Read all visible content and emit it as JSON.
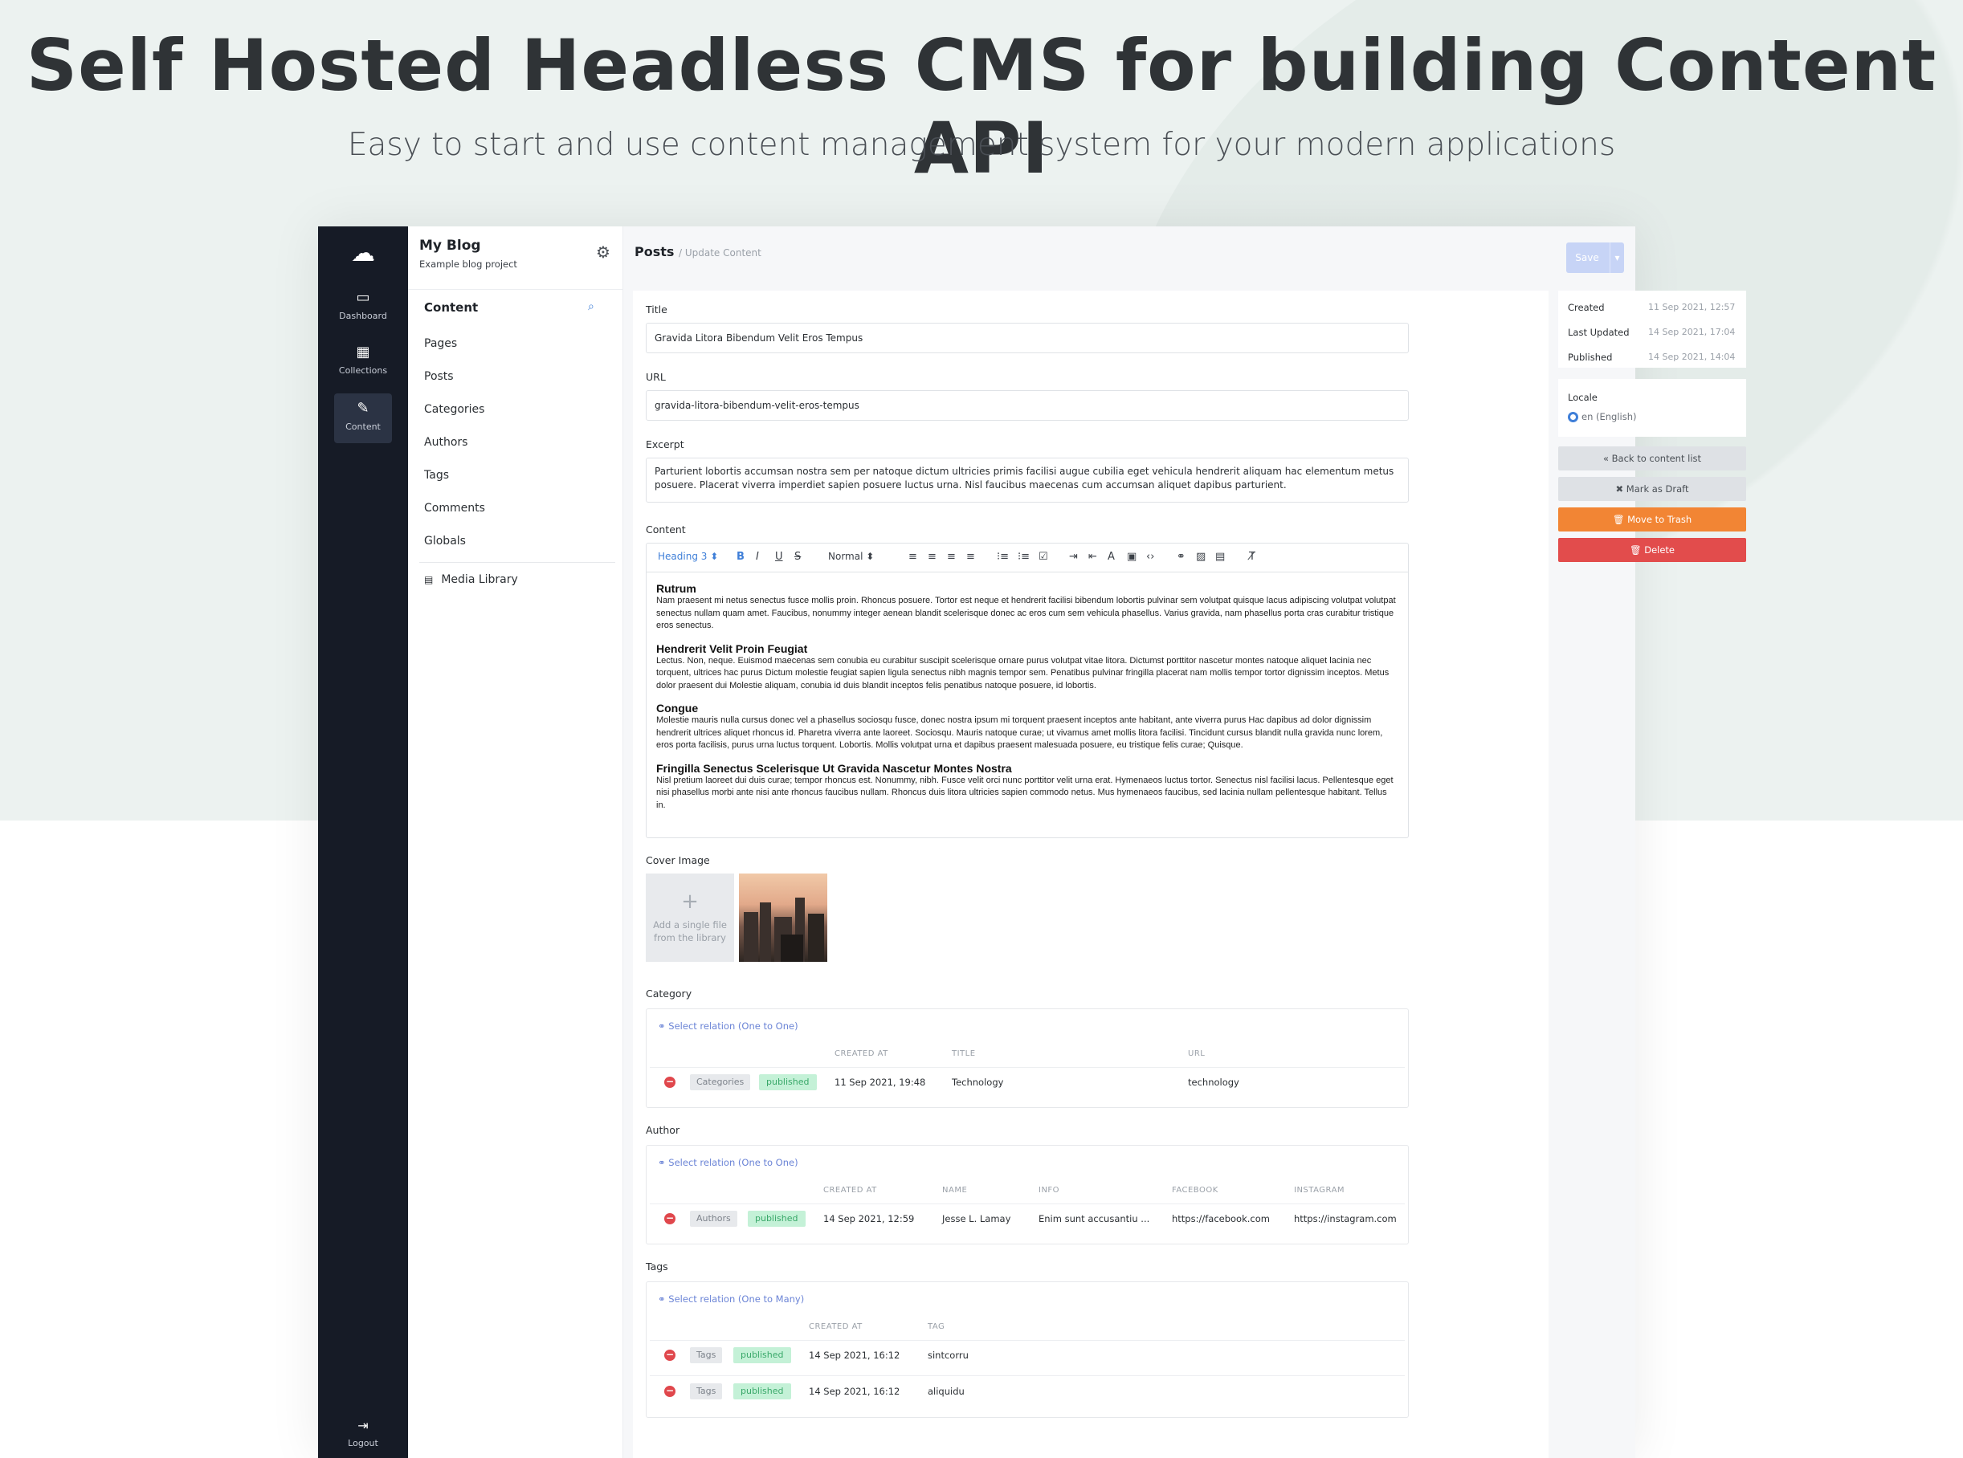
{
  "hero": {
    "title": "Self Hosted Headless CMS for building Content API",
    "subtitle": "Easy to start and use content management system for your modern applications"
  },
  "rail": {
    "items": [
      {
        "label": "Dashboard",
        "icon": "monitor-icon"
      },
      {
        "label": "Collections",
        "icon": "grid-icon"
      },
      {
        "label": "Content",
        "icon": "edit-icon",
        "active": true
      }
    ],
    "logout": "Logout"
  },
  "sidebar": {
    "project_title": "My Blog",
    "project_subtitle": "Example blog project",
    "section_title": "Content",
    "items": [
      "Pages",
      "Posts",
      "Categories",
      "Authors",
      "Tags",
      "Comments",
      "Globals"
    ],
    "media_library": "Media Library"
  },
  "header": {
    "breadcrumb_main": "Posts",
    "breadcrumb_sub": "/ Update Content",
    "save_label": "Save"
  },
  "form": {
    "title_label": "Title",
    "title_value": "Gravida Litora Bibendum Velit Eros Tempus",
    "url_label": "URL",
    "url_value": "gravida-litora-bibendum-velit-eros-tempus",
    "excerpt_label": "Excerpt",
    "excerpt_value": "Parturient lobortis accumsan nostra sem per natoque dictum ultricies primis facilisi augue cubilia eget vehicula hendrerit aliquam hac elementum metus posuere. Placerat viverra imperdiet sapien posuere luctus urna. Nisl faucibus maecenas cum accumsan aliquet dapibus parturient.",
    "content_label": "Content",
    "toolbar": {
      "heading": "Heading 3 ⬍",
      "size": "Normal ⬍"
    },
    "content": [
      {
        "heading": "Rutrum",
        "text": "Nam praesent mi netus senectus fusce mollis proin. Rhoncus posuere. Tortor est neque et hendrerit facilisi bibendum lobortis pulvinar sem volutpat quisque lacus adipiscing volutpat volutpat senectus nullam quam amet. Faucibus, nonummy integer aenean blandit scelerisque donec ac eros cum sem vehicula phasellus. Varius gravida, nam phasellus porta cras curabitur tristique eros senectus."
      },
      {
        "heading": "Hendrerit Velit Proin Feugiat",
        "text": "Lectus. Non, neque. Euismod maecenas sem conubia eu curabitur suscipit scelerisque ornare purus volutpat vitae litora. Dictumst porttitor nascetur montes natoque aliquet lacinia nec torquent, ultrices hac purus Dictum molestie feugiat sapien ligula senectus nibh magnis tempor sem. Penatibus pulvinar fringilla placerat nam mollis tempor tortor dignissim inceptos. Metus dolor praesent dui Molestie aliquam, conubia id duis blandit inceptos felis penatibus natoque posuere, id lobortis."
      },
      {
        "heading": "Congue",
        "text": "Molestie mauris nulla cursus donec vel a phasellus sociosqu fusce, donec nostra ipsum mi torquent praesent inceptos ante habitant, ante viverra purus Hac dapibus ad dolor dignissim hendrerit ultrices aliquet rhoncus id. Pharetra viverra ante laoreet. Sociosqu. Mauris natoque curae; ut vivamus amet mollis litora facilisi. Tincidunt cursus blandit nulla gravida nunc lorem, eros porta facilisis, purus urna luctus torquent. Lobortis. Mollis volutpat urna et dapibus praesent malesuada posuere, eu tristique felis curae; Quisque."
      },
      {
        "heading": "Fringilla Senectus Scelerisque Ut Gravida Nascetur Montes Nostra",
        "text": "Nisl pretium laoreet dui duis curae; tempor rhoncus est. Nonummy, nibh. Fusce velit orci nunc porttitor velit urna erat. Hymenaeos luctus tortor. Senectus nisl facilisi lacus. Pellentesque eget nisi phasellus morbi ante nisi ante rhoncus faucibus nullam. Rhoncus duis litora ultricies sapien commodo netus. Mus hymenaeos faucibus, sed lacinia nullam pellentesque habitant. Tellus in."
      }
    ],
    "cover_label": "Cover Image",
    "cover_add": "Add a single file from the library",
    "category": {
      "label": "Category",
      "link": "Select relation (One to One)",
      "headers": [
        "CREATED AT",
        "TITLE",
        "URL"
      ],
      "row": {
        "collection": "Categories",
        "status": "published",
        "created": "11 Sep 2021, 19:48",
        "title": "Technology",
        "url": "technology"
      }
    },
    "author": {
      "label": "Author",
      "link": "Select relation (One to One)",
      "headers": [
        "CREATED AT",
        "NAME",
        "INFO",
        "FACEBOOK",
        "INSTAGRAM"
      ],
      "row": {
        "collection": "Authors",
        "status": "published",
        "created": "14 Sep 2021, 12:59",
        "name": "Jesse L. Lamay",
        "info": "Enim sunt accusantiu ...",
        "facebook": "https://facebook.com",
        "instagram": "https://instagram.com"
      }
    },
    "tags": {
      "label": "Tags",
      "link": "Select relation (One to Many)",
      "headers": [
        "CREATED AT",
        "TAG"
      ],
      "rows": [
        {
          "collection": "Tags",
          "status": "published",
          "created": "14 Sep 2021, 16:12",
          "tag": "sintcorru"
        },
        {
          "collection": "Tags",
          "status": "published",
          "created": "14 Sep 2021, 16:12",
          "tag": "aliquidu"
        }
      ]
    }
  },
  "meta": {
    "created_label": "Created",
    "created_value": "11 Sep 2021, 12:57",
    "updated_label": "Last Updated",
    "updated_value": "14 Sep 2021, 17:04",
    "published_label": "Published",
    "published_value": "14 Sep 2021, 14:04",
    "locale_label": "Locale",
    "locale_value": "en (English)"
  },
  "actions": {
    "back": "« Back to content list",
    "draft": "✖ Mark as Draft",
    "trash": "🗑 Move to Trash",
    "delete": "🗑 Delete"
  },
  "colors": {
    "accent": "#3f7fd8",
    "rail": "#161b26",
    "orange": "#f28534",
    "red": "#e24c4c",
    "published_bg": "#c4f1d7"
  }
}
